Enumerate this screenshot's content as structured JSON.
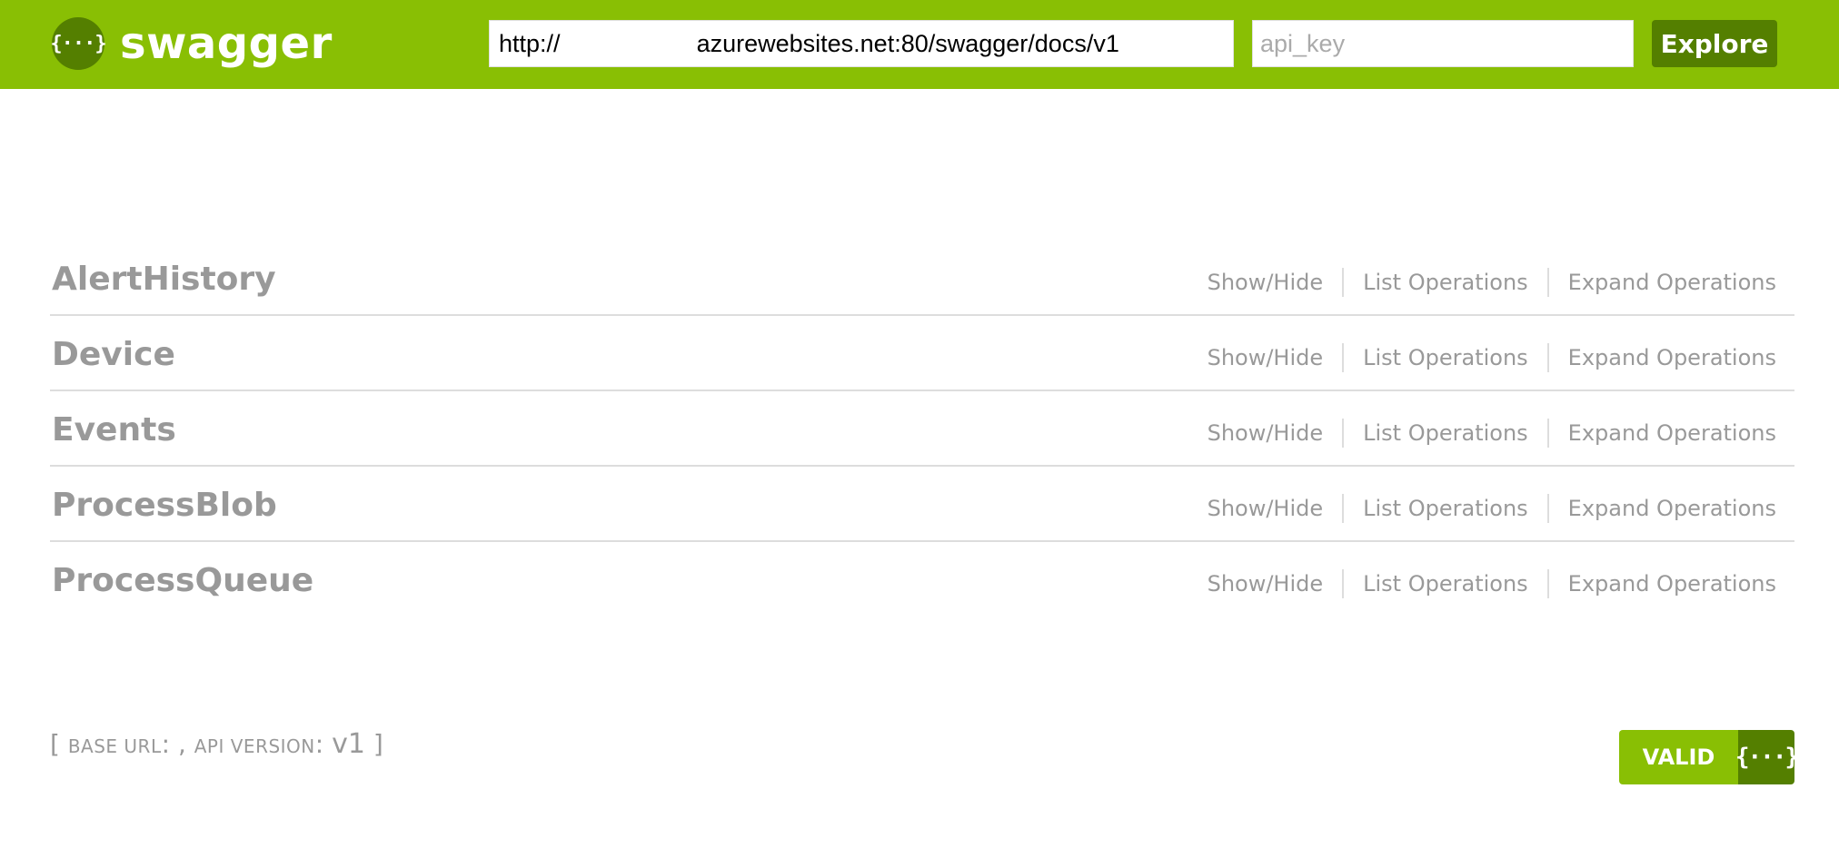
{
  "header": {
    "logo_icon": "{···}",
    "logo_text": "swagger",
    "url_value": "http://                    azurewebsites.net:80/swagger/docs/v1",
    "api_key_placeholder": "api_key",
    "explore_label": "Explore"
  },
  "resources": [
    {
      "name": "AlertHistory",
      "show_hide": "Show/Hide",
      "list_ops": "List Operations",
      "expand_ops": "Expand Operations"
    },
    {
      "name": "Device",
      "show_hide": "Show/Hide",
      "list_ops": "List Operations",
      "expand_ops": "Expand Operations"
    },
    {
      "name": "Events",
      "show_hide": "Show/Hide",
      "list_ops": "List Operations",
      "expand_ops": "Expand Operations"
    },
    {
      "name": "ProcessBlob",
      "show_hide": "Show/Hide",
      "list_ops": "List Operations",
      "expand_ops": "Expand Operations"
    },
    {
      "name": "ProcessQueue",
      "show_hide": "Show/Hide",
      "list_ops": "List Operations",
      "expand_ops": "Expand Operations"
    }
  ],
  "footer": {
    "open_bracket": "[ ",
    "base_url_label": "BASE URL",
    "base_url_sep": ": , ",
    "api_version_label": "API VERSION",
    "api_version_sep": ": ",
    "api_version_value": "v1",
    "close_bracket": " ]",
    "validator_label": "VALID",
    "validator_icon": "{···}"
  },
  "colors": {
    "header_bg": "#89bf04",
    "accent_dark": "#547f00",
    "muted_text": "#999999",
    "divider": "#dddddd"
  }
}
